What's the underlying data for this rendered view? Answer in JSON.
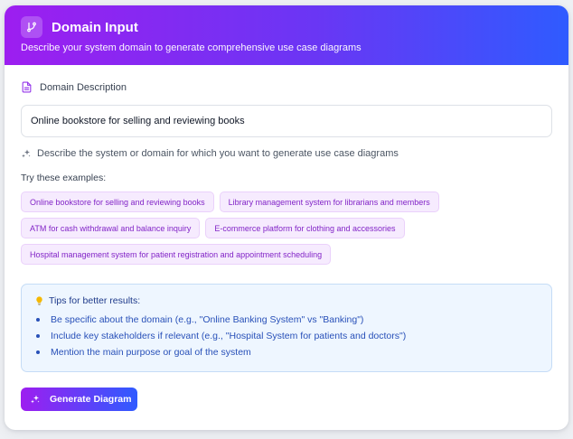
{
  "header": {
    "title": "Domain Input",
    "subtitle": "Describe your system domain to generate comprehensive use case diagrams",
    "icon": "git-branch-icon"
  },
  "domain": {
    "label": "Domain Description",
    "label_icon": "document-icon",
    "value": "Online bookstore for selling and reviewing books"
  },
  "hint": {
    "icon": "sparkles-icon",
    "text": "Describe the system or domain for which you want to generate use case diagrams"
  },
  "examples": {
    "title": "Try these examples:",
    "items": [
      "Online bookstore for selling and reviewing books",
      "Library management system for librarians and members",
      "ATM for cash withdrawal and balance inquiry",
      "E-commerce platform for clothing and accessories",
      "Hospital management system for patient registration and appointment scheduling"
    ]
  },
  "tips": {
    "icon": "lightbulb-icon",
    "title": "Tips for better results:",
    "items": [
      "Be specific about the domain (e.g., \"Online Banking System\" vs \"Banking\")",
      "Include key stakeholders if relevant (e.g., \"Hospital System for patients and doctors\")",
      "Mention the main purpose or goal of the system"
    ]
  },
  "button": {
    "label": "Generate Diagram",
    "icon": "sparkles-icon"
  },
  "colors": {
    "gradient_start": "#9d1ef0",
    "gradient_end": "#2f5bff",
    "chip_text": "#8224c7",
    "tip_text": "#2850b8"
  }
}
